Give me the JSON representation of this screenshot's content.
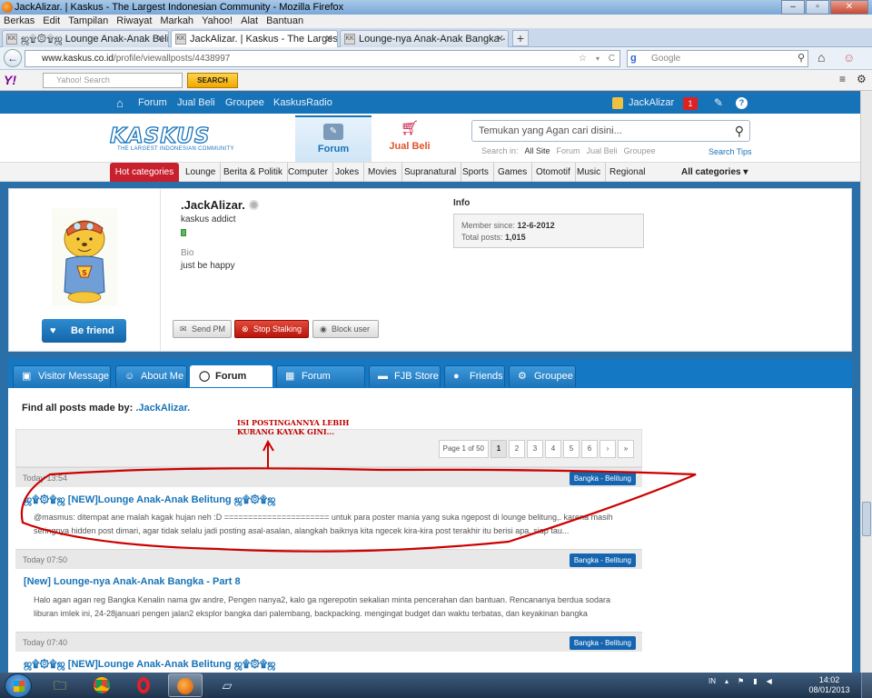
{
  "window": {
    "title": "JackAlizar. | Kaskus - The Largest Indonesian Community - Mozilla Firefox",
    "controls": [
      "–",
      "▫",
      "✕"
    ]
  },
  "menubar": [
    "Berkas",
    "Edit",
    "Tampilan",
    "Riwayat",
    "Markah",
    "Yahoo!",
    "Alat",
    "Bantuan"
  ],
  "tabs": [
    {
      "label": "ஜ۩۞۩ஜ Lounge Anak-Anak Belitung ...",
      "favicon": "KK"
    },
    {
      "label": "JackAlizar. | Kaskus - The Largest Ind...",
      "favicon": "KK"
    },
    {
      "label": "Lounge-nya Anak-Anak Bangka - Par...",
      "favicon": "KK"
    }
  ],
  "newtab_symbol": "+",
  "nav": {
    "back_symbol": "←",
    "url_host": "www.kaskus.co.id",
    "url_path": "/profile/viewallposts/4438997",
    "star": "☆",
    "dropdown": "▾",
    "reload": "C",
    "search_engine_symbol": "g",
    "search_placeholder": "Google",
    "search_glass": "⚲",
    "home_symbol": "⌂",
    "addon_symbol": "☺"
  },
  "yahoo": {
    "logo": "Y!",
    "search_placeholder": "Yahoo! Search",
    "search_button": "SEARCH",
    "menu_symbol": "≡",
    "gear_symbol": "⚙"
  },
  "kaskus_topbar": {
    "home_symbol": "⌂",
    "items": [
      "Forum",
      "Jual Beli",
      "Groupee",
      "KaskusRadio"
    ],
    "username": "JackAlizar",
    "notif_count": "1",
    "edit_symbol": "✎",
    "help_symbol": "?"
  },
  "kaskus_header": {
    "logo_text": "KASKUS",
    "logo_tagline": "THE LARGEST INDONESIAN COMMUNITY",
    "forum_label": "Forum",
    "jualbeli_label": "Jual Beli",
    "search_placeholder": "Temukan yang Agan cari disini...",
    "search_in_label": "Search in:",
    "search_in_options": [
      "All Site",
      "Forum",
      "Jual Beli",
      "Groupee"
    ],
    "search_tips": "Search Tips"
  },
  "categories": {
    "hot": "Hot categories",
    "items": [
      "Lounge",
      "Berita & Politik",
      "Computer",
      "Jokes",
      "Movies",
      "Supranatural",
      "Sports",
      "Games",
      "Otomotif",
      "Music",
      "Regional"
    ],
    "all": "All categories ▾"
  },
  "profile": {
    "username": ".JackAlizar.",
    "rank": "kaskus addict",
    "bio_label": "Bio",
    "bio_text": "just be happy",
    "info_label": "Info",
    "member_since_label": "Member since:",
    "member_since": "12-6-2012",
    "total_posts_label": "Total posts:",
    "total_posts": "1,015",
    "be_friend": "Be friend",
    "send_pm": "Send PM",
    "stop_stalking": "Stop Stalking",
    "block_user": "Block user"
  },
  "profile_tabs": [
    {
      "label": "Visitor Message",
      "icon": "▣"
    },
    {
      "label": "About Me",
      "icon": "☺"
    },
    {
      "label": "Forum Posts",
      "icon": "◯"
    },
    {
      "label": "Forum Thread",
      "icon": "▦"
    },
    {
      "label": "FJB Store",
      "icon": "▬"
    },
    {
      "label": "Friends",
      "icon": "●"
    },
    {
      "label": "Groupee",
      "icon": "⚙"
    }
  ],
  "posts_section": {
    "find_label": "Find all posts made by:",
    "find_user": ".JackAlizar.",
    "pager_label": "Page 1 of 50",
    "pages": [
      "1",
      "2",
      "3",
      "4",
      "5",
      "6",
      "›",
      "»"
    ]
  },
  "posts": [
    {
      "time": "Today 13:54",
      "badge": "Bangka - Belitung",
      "title": "ஜ۩۞۩ஜ [NEW]Lounge Anak-Anak Belitung ஜ۩۞۩ஜ",
      "body1": "@masmus: ditempat ane malah kagak hujan neh :D ====================== untuk para poster mania yang suka ngepost di lounge belitung,. karena masih",
      "body2": "seringnya hidden post dimari, agar tidak selalu jadi posting asal-asalan, alangkah baiknya kita ngecek kira-kira post terakhir itu berisi apa. siap tau..."
    },
    {
      "time": "Today 07:50",
      "badge": "Bangka - Belitung",
      "title": "[New] Lounge-nya Anak-Anak Bangka - Part 8",
      "body1": "Halo agan agan reg Bangka Kenalin nama gw andre, Pengen nanya2, kalo ga ngerepotin sekalian minta pencerahan dan bantuan. Rencananya berdua sodara",
      "body2": "liburan imlek ini, 24-28januari pengen jalan2 eksplor bangka dari palembang, backpacking. mengingat budget dan waktu terbatas, dan keyakinan bangka"
    },
    {
      "time": "Today 07:40",
      "badge": "Bangka - Belitung",
      "title": "ஜ۩۞۩ஜ [NEW]Lounge Anak-Anak Belitung ஜ۩۞۩ஜ",
      "body1": "",
      "body2": ""
    }
  ],
  "annotation": {
    "line1": "ISI POSTINGANNYA LEBIH",
    "line2": "KURANG KAYAK GINI...",
    "color": "#cc0000"
  },
  "taskbar": {
    "language": "IN",
    "time": "14:02",
    "date": "08/01/2013"
  }
}
